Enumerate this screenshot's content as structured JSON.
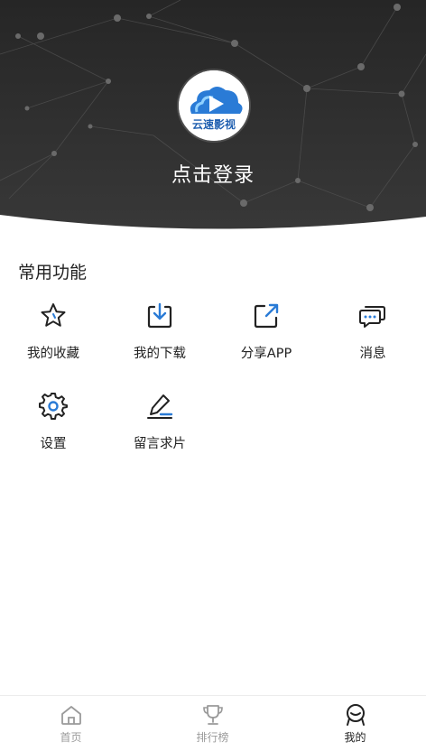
{
  "header": {
    "login_text": "点击登录",
    "avatar_logo_text": "云速影视"
  },
  "section": {
    "title": "常用功能",
    "items": [
      {
        "label": "我的收藏",
        "icon": "star-icon"
      },
      {
        "label": "我的下载",
        "icon": "download-icon"
      },
      {
        "label": "分享APP",
        "icon": "share-icon"
      },
      {
        "label": "消息",
        "icon": "message-icon"
      },
      {
        "label": "设置",
        "icon": "gear-icon"
      },
      {
        "label": "留言求片",
        "icon": "edit-icon"
      }
    ]
  },
  "bottom_nav": {
    "items": [
      {
        "label": "首页",
        "icon": "home-icon",
        "active": false
      },
      {
        "label": "排行榜",
        "icon": "trophy-icon",
        "active": false
      },
      {
        "label": "我的",
        "icon": "profile-icon",
        "active": true
      }
    ]
  },
  "colors": {
    "header_bg": "#2b2b2b",
    "accent_blue": "#2a7bd6",
    "active_text": "#222222",
    "inactive_text": "#9a9a9a"
  }
}
